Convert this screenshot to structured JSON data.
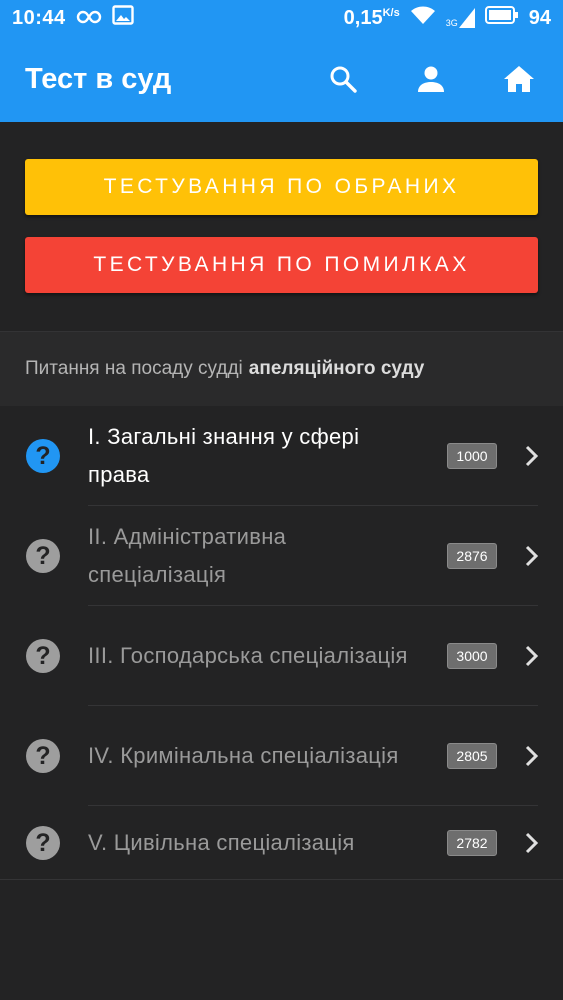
{
  "status_bar": {
    "time": "10:44",
    "speed": "0,15",
    "speed_unit": "K/s",
    "network": "3G",
    "battery": "94",
    "icons": [
      "infinity-icon",
      "image-icon",
      "wifi-icon",
      "signal-icon",
      "battery-icon"
    ]
  },
  "app_bar": {
    "title": "Тест в суд",
    "background": "#2196f3",
    "actions": [
      "search-icon",
      "account-icon",
      "home-icon"
    ]
  },
  "buttons": {
    "favorites_label": "ТЕСТУВАННЯ ПО ОБРАНИХ",
    "favorites_color": "#ffc107",
    "mistakes_label": "ТЕСТУВАННЯ ПО ПОМИЛКАХ",
    "mistakes_color": "#f44336"
  },
  "section": {
    "prefix": "Питання на посаду судді",
    "bold": "апеляційного суду"
  },
  "items": [
    {
      "label": "І. Загальні знання у сфері права",
      "count": "1000",
      "active": true,
      "icon_color": "#2196f3"
    },
    {
      "label": "ІІ. Адміністративна спеціалізація",
      "count": "2876",
      "active": false,
      "icon_color": "#9e9e9e"
    },
    {
      "label": "ІІІ. Господарська спеціалізація",
      "count": "3000",
      "active": false,
      "icon_color": "#9e9e9e"
    },
    {
      "label": "IV. Кримінальна спеціалізація",
      "count": "2805",
      "active": false,
      "icon_color": "#9e9e9e"
    },
    {
      "label": "V. Цивільна спеціалізація",
      "count": "2782",
      "active": false,
      "icon_color": "#9e9e9e"
    }
  ],
  "colors": {
    "active_text": "#ffffff",
    "inactive_text": "#9a9a9a"
  }
}
